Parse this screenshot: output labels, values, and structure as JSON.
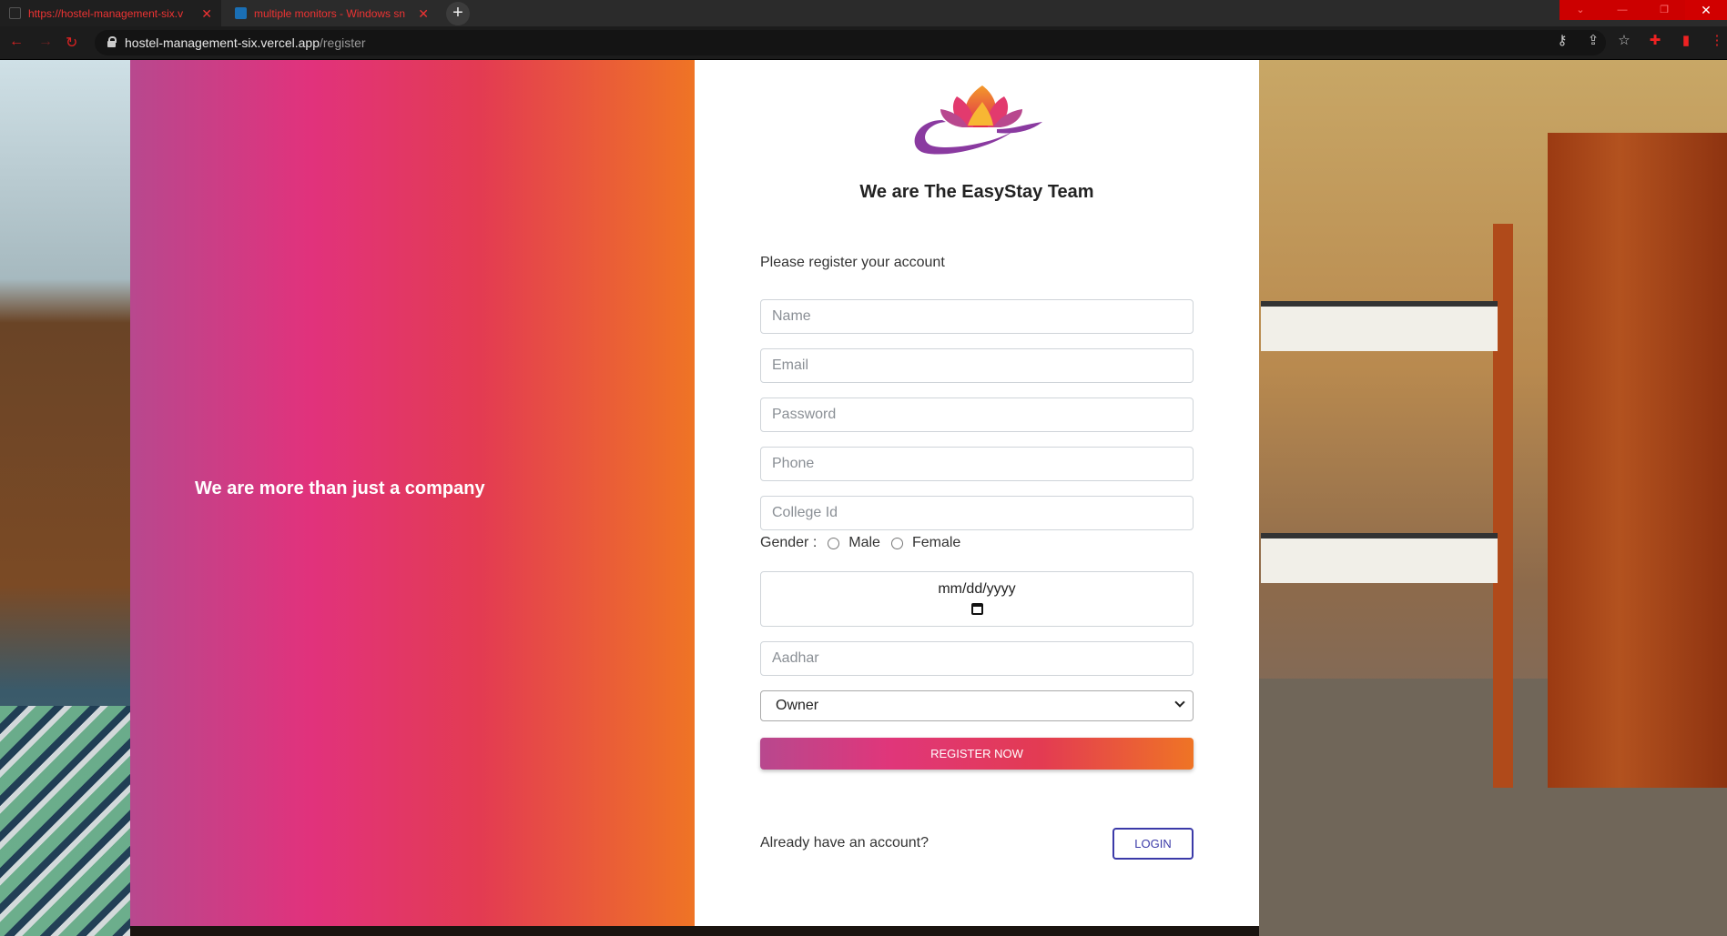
{
  "browser": {
    "tabs": [
      {
        "title": "https://hostel-management-six.v",
        "active": true
      },
      {
        "title": "multiple monitors - Windows sn",
        "active": false
      }
    ],
    "new_tab": "+",
    "url_host": "hostel-management-six.vercel.app",
    "url_path": "/register"
  },
  "hero": {
    "tagline": "We are more than just a company"
  },
  "form": {
    "heading": "We are The EasyStay Team",
    "prompt": "Please register your account",
    "name_placeholder": "Name",
    "email_placeholder": "Email",
    "password_placeholder": "Password",
    "phone_placeholder": "Phone",
    "college_placeholder": "College Id",
    "gender_label": "Gender :",
    "gender_options": [
      "Male",
      "Female"
    ],
    "date_placeholder": "mm/dd/yyyy",
    "aadhar_placeholder": "Aadhar",
    "role_selected": "Owner",
    "register_label": "REGISTER NOW",
    "already_text": "Already have an account?",
    "login_label": "LOGIN"
  },
  "colors": {
    "gradient_start": "#b8488e",
    "gradient_mid": "#e1327c",
    "gradient_end": "#ef7425",
    "login_accent": "#3b3aa8"
  },
  "icons": [
    "lock-icon",
    "calendar-icon",
    "chevron-down-icon",
    "lotus-logo"
  ]
}
